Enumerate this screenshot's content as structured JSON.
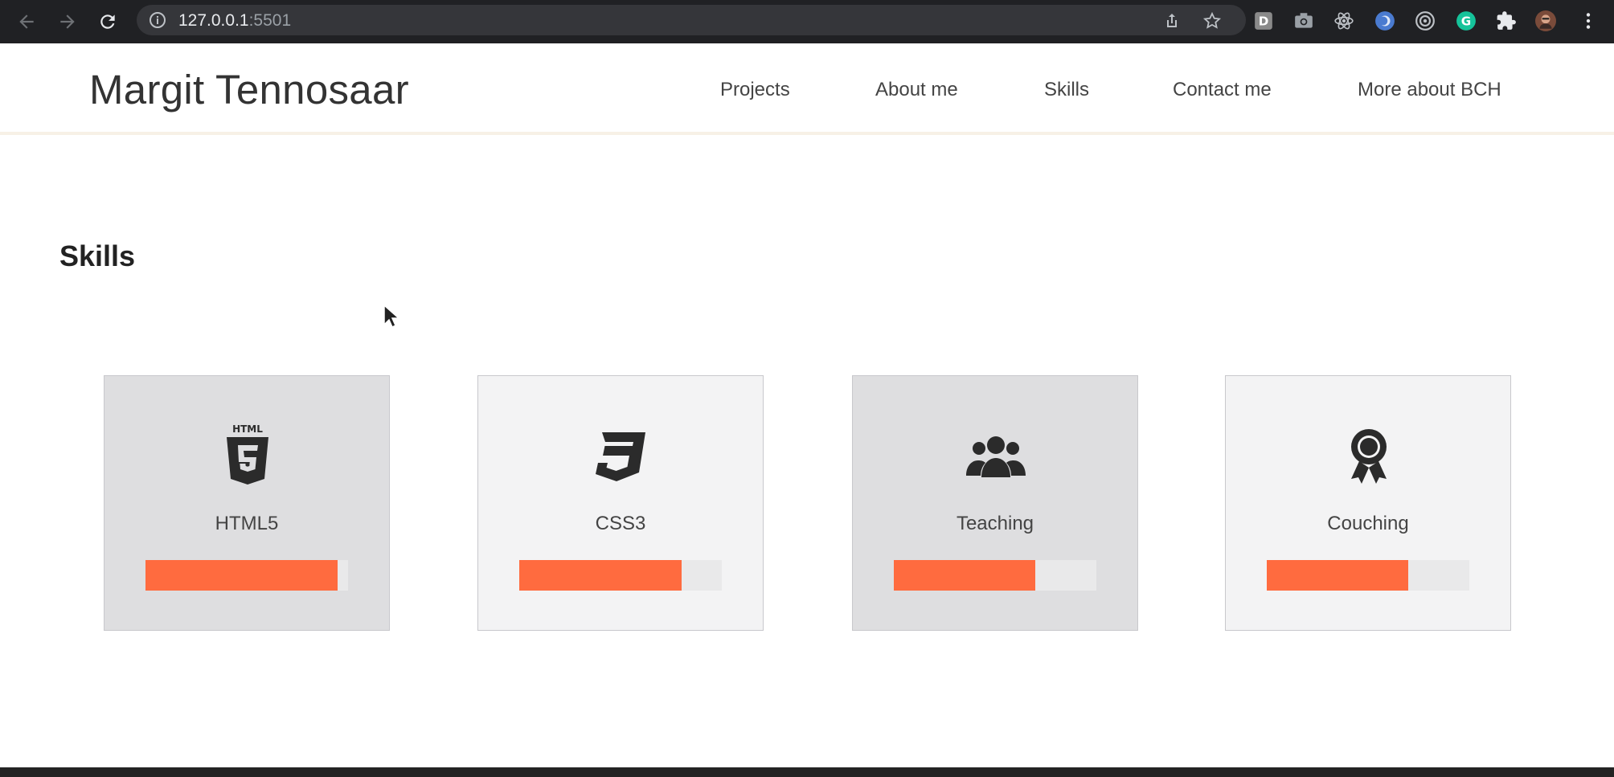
{
  "browser": {
    "url_host": "127.0.0.1",
    "url_port": ":5501",
    "icons": [
      "back-icon",
      "forward-icon",
      "reload-icon",
      "site-info-icon",
      "share-icon",
      "bookmark-star-icon"
    ],
    "extensions": [
      {
        "name": "extension-d",
        "letter": "D"
      },
      {
        "name": "camera-extension"
      },
      {
        "name": "react-devtools-extension"
      },
      {
        "name": "blue-circle-extension"
      },
      {
        "name": "target-extension"
      },
      {
        "name": "grammarly-extension",
        "letter": "G"
      },
      {
        "name": "extensions-puzzle"
      },
      {
        "name": "profile-avatar"
      },
      {
        "name": "menu-kebab"
      }
    ]
  },
  "site": {
    "brand": "Margit Tennosaar",
    "nav": [
      "Projects",
      "About me",
      "Skills",
      "Contact me",
      "More about BCH"
    ]
  },
  "skills_section": {
    "title": "Skills",
    "cards": [
      {
        "label": "HTML5",
        "icon": "html5-icon",
        "level": 0.95,
        "style": "dark"
      },
      {
        "label": "CSS3",
        "icon": "css3-icon",
        "level": 0.8,
        "style": "light"
      },
      {
        "label": "Teaching",
        "icon": "people-group-icon",
        "level": 0.7,
        "style": "dark"
      },
      {
        "label": "Couching",
        "icon": "award-ribbon-icon",
        "level": 0.7,
        "style": "light"
      }
    ]
  },
  "colors": {
    "accent": "#ff6b3f",
    "chrome_bg": "#202124",
    "card_dark": "#dedee0",
    "card_light": "#f3f3f4"
  }
}
